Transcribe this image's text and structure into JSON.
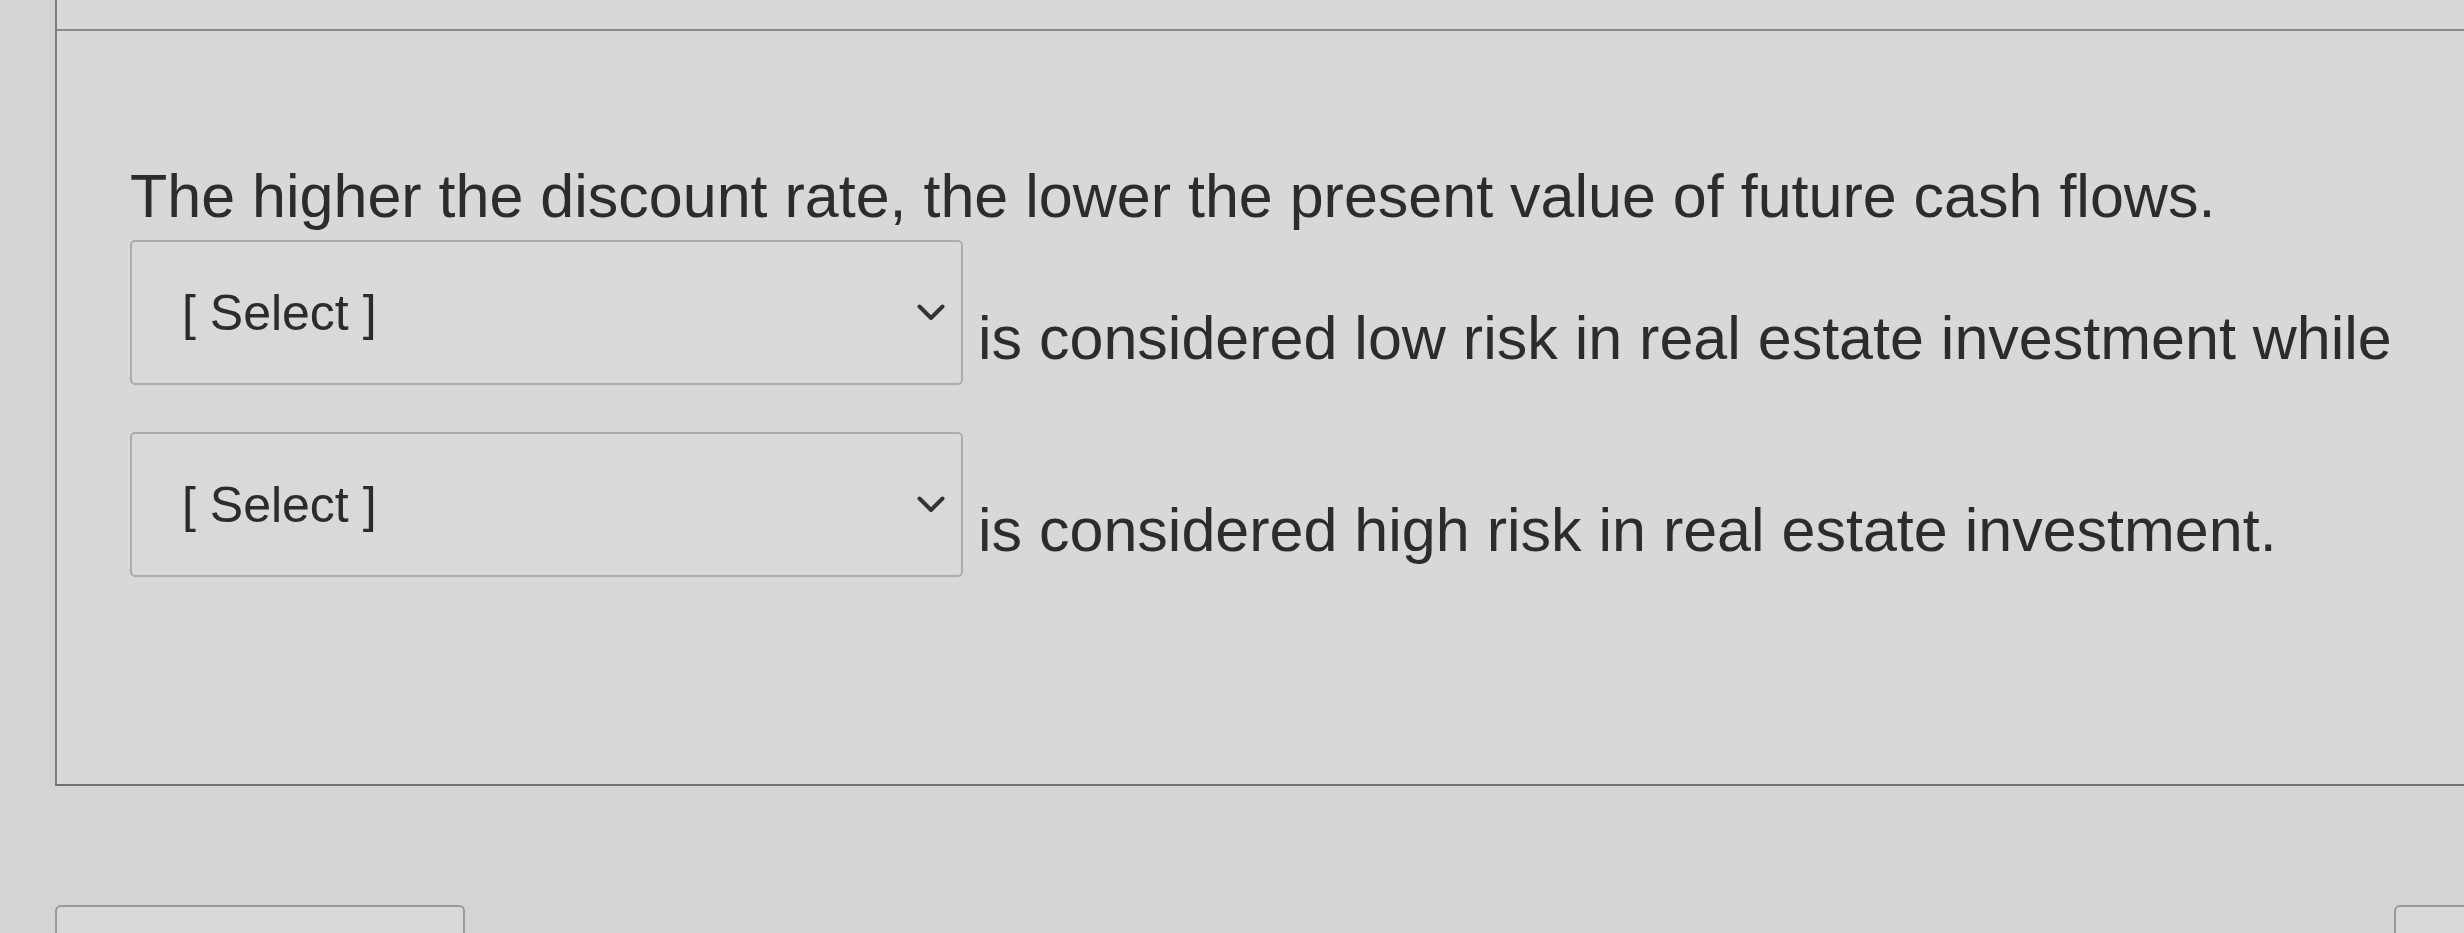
{
  "question": {
    "prompt": "The higher the discount rate, the lower the present value of future cash flows.",
    "rows": [
      {
        "dropdown": {
          "value": "[ Select ]"
        },
        "text": "is considered low risk in real estate investment while"
      },
      {
        "dropdown": {
          "value": "[ Select ]"
        },
        "text": "is considered high risk in real estate investment."
      }
    ]
  }
}
